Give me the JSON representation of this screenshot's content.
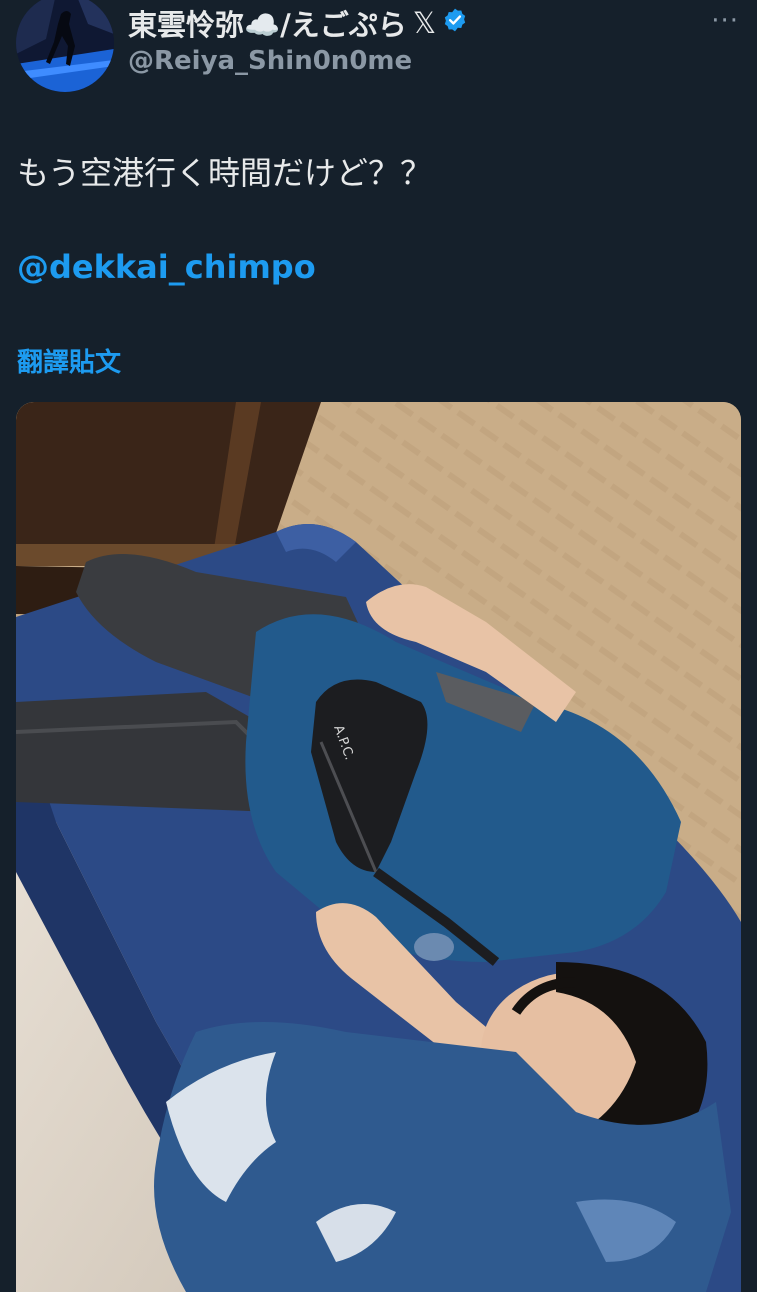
{
  "author": {
    "display_name": "東雲怜弥☁️/えごぷら",
    "handle": "@Reiya_Shin0n0me",
    "x_glyph": "𝕏"
  },
  "menu_glyph": "···",
  "tweet": {
    "text": "もう空港行く時間だけど？？",
    "mention": "@dekkai_chimpo",
    "translate_label": "翻譯貼文"
  },
  "photo_text": "A.P.C.",
  "colors": {
    "background": "#15202b",
    "text": "#e7e9ea",
    "secondary": "#8b98a5",
    "link": "#1d9bf0",
    "verified": "#1d9bf0"
  },
  "icons": [
    "avatar",
    "x-logo-icon",
    "verified-badge-icon",
    "more-options-icon"
  ]
}
